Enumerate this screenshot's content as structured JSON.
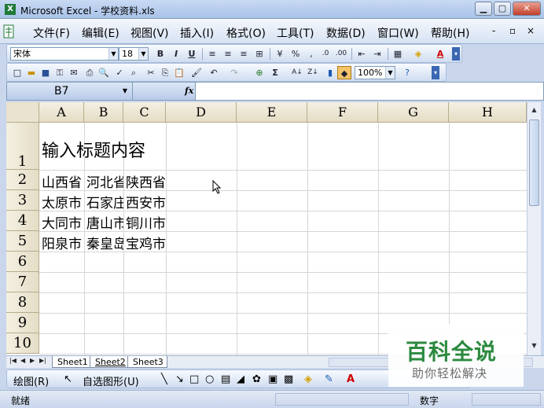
{
  "window": {
    "title": "Microsoft Excel - 学校资料.xls",
    "app_icon": "excel-icon",
    "controls": [
      "minimize",
      "maximize",
      "close"
    ]
  },
  "menubar": {
    "items": [
      "文件(F)",
      "编辑(E)",
      "视图(V)",
      "插入(I)",
      "格式(O)",
      "工具(T)",
      "数据(D)",
      "窗口(W)",
      "帮助(H)"
    ],
    "doc_controls": [
      "-",
      "▫",
      "×"
    ]
  },
  "format_toolbar": {
    "font_name": "宋体",
    "font_size": "18",
    "bold": "B",
    "italic": "I",
    "underline": "U",
    "percent": "%",
    "comma": ","
  },
  "standard_toolbar": {
    "zoom": "100%",
    "sigma": "Σ"
  },
  "formula_bar": {
    "name_box": "B7",
    "fx": "fx",
    "formula": ""
  },
  "sheet": {
    "columns": [
      "A",
      "B",
      "C",
      "D",
      "E",
      "F",
      "G",
      "H"
    ],
    "rows": [
      "1",
      "2",
      "3",
      "4",
      "5",
      "6",
      "7",
      "8",
      "9",
      "10"
    ],
    "cells": {
      "A1": "输入标题内容",
      "A2": "山西省",
      "B2": "河北省",
      "C2": "陕西省",
      "A3": "太原市",
      "B3": "石家庄",
      "C3": "西安市",
      "A4": "大同市",
      "B4": "唐山市",
      "C4": "铜川市",
      "A5": "阳泉市",
      "B5": "秦皇岛",
      "C5": "宝鸡市"
    },
    "selected_cell": "B7"
  },
  "sheet_tabs": {
    "tabs": [
      "Sheet1",
      "Sheet2",
      "Sheet3"
    ],
    "active": "Sheet2"
  },
  "drawing_toolbar": {
    "draw_label": "绘图(R)",
    "autoshapes_label": "自选图形(U)"
  },
  "statusbar": {
    "ready": "就绪",
    "num": "数字"
  },
  "watermark": {
    "title": "百科全说",
    "subtitle": "助你轻松解决"
  }
}
